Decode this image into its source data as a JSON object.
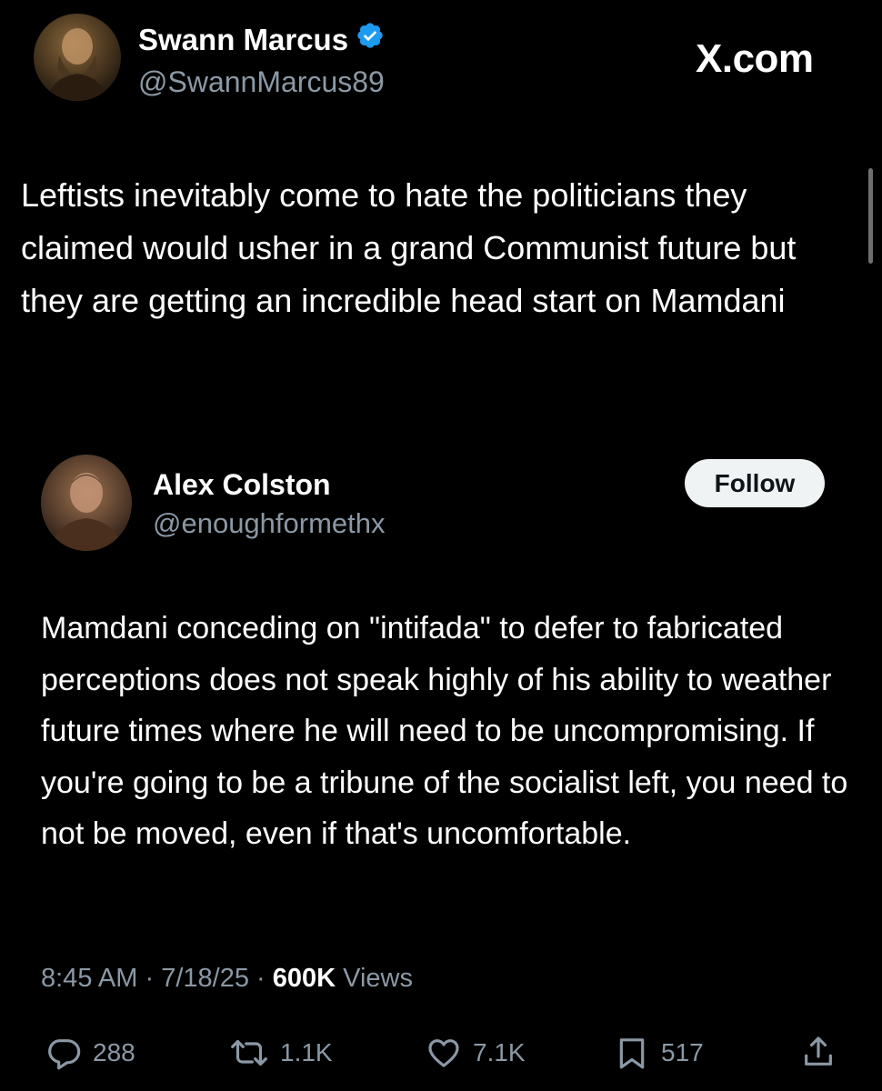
{
  "site_label": "X.com",
  "colors": {
    "background": "#000000",
    "text": "#ffffff",
    "muted": "#8b98a5",
    "verified_badge": "#1d9bf0",
    "follow_button_bg": "#eff3f4",
    "follow_button_text": "#0f1419"
  },
  "outer_tweet": {
    "author": {
      "name": "Swann Marcus",
      "handle": "@SwannMarcus89",
      "verified": true
    },
    "text": "Leftists inevitably come to hate the politicians they claimed would usher in a grand Communist future but they are getting an incredible head start on Mamdani"
  },
  "quoted_tweet": {
    "author": {
      "name": "Alex Colston",
      "handle": "@enoughformethx"
    },
    "follow_label": "Follow",
    "text": "Mamdani conceding on \"intifada\" to defer to fabricated perceptions does not speak highly of his ability to weather future times where he will need to be uncompromising. If you're going to be a tribune of the socialist left, you need to not be moved, even if that's uncomfortable."
  },
  "meta": {
    "time": "8:45 AM",
    "separator": "·",
    "date": "7/18/25",
    "views_count": "600K",
    "views_label": "Views"
  },
  "actions": {
    "replies": {
      "icon": "reply-icon",
      "count": "288"
    },
    "reposts": {
      "icon": "repost-icon",
      "count": "1.1K"
    },
    "likes": {
      "icon": "heart-icon",
      "count": "7.1K"
    },
    "bookmarks": {
      "icon": "bookmark-icon",
      "count": "517"
    },
    "share": {
      "icon": "share-icon"
    }
  }
}
